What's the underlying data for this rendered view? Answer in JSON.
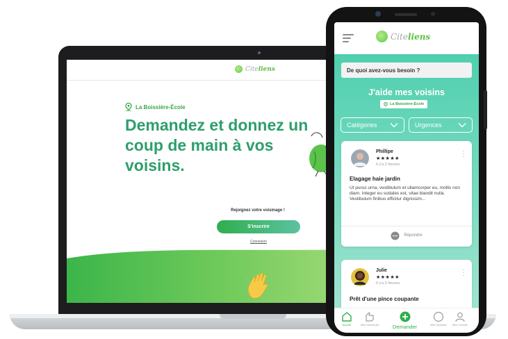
{
  "colors": {
    "brand_green": "#2fae4d",
    "heading_teal": "#2e9e6c",
    "mobile_gradient_top": "#4fcfae",
    "mobile_gradient_bottom": "#9fe3d0"
  },
  "brand": {
    "name_part1": "Cite",
    "name_part2": "liens"
  },
  "desktop": {
    "location": "La Boissière-École",
    "heading": "Demandez et donnez un coup de main à vos voisins.",
    "join_text": "Rejoignez votre voisinage !",
    "signup_label": "S'inscrire",
    "login_label": "Connexion"
  },
  "mobile": {
    "search_placeholder": "De quoi avez-vous besoin ?",
    "section_title": "J'aide mes voisins",
    "location": "La Boissière-École",
    "filters": {
      "categories_label": "Catégories",
      "urgences_label": "Urgences"
    },
    "posts": [
      {
        "author": "Phillipe",
        "stars": "★★★★★",
        "rating": 5,
        "time": "Il y'a 2 heures",
        "title": "Elagage haie jardin",
        "text": "Ut purus urna, vestibulum et ullamcorper eu, mollis non diam. Integer eu sodales est, vitae blandit nulla. Vestibulum finibus efficitur dignissim...",
        "reply_label": "Répondre"
      },
      {
        "author": "Julie",
        "stars": "★★★★★",
        "rating": 5,
        "time": "Il y'a 2 heures",
        "title": "Prêt d'une pince coupante"
      }
    ],
    "nav": {
      "home": "Accueil",
      "requests": "Mes Demandes",
      "ask": "Demander",
      "answers": "Mes réponses",
      "account": "Mon Compte"
    }
  }
}
